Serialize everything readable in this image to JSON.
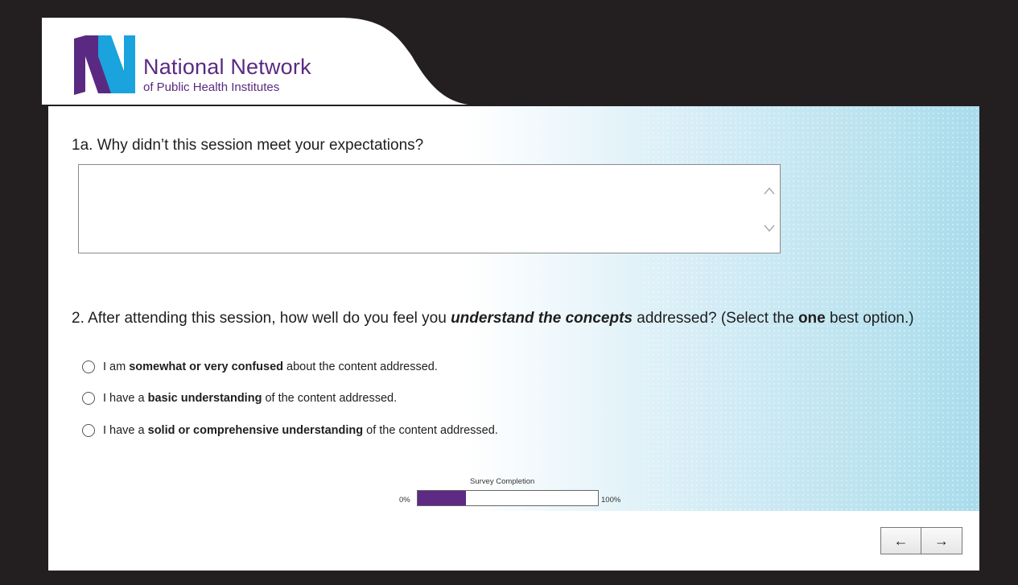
{
  "logo": {
    "line1": "National Network",
    "line2": "of Public Health Institutes",
    "color": "#5a2a82",
    "accent": "#1aa3dd"
  },
  "question1": {
    "text": "1a. Why didn’t this session meet your expectations?",
    "value": "",
    "scroll_up": "^",
    "scroll_down": "v"
  },
  "question2": {
    "part1": "2. After attending this session, how well do you feel you ",
    "emph": "understand the concepts",
    "part2": " addressed? (Select the ",
    "bold": "one",
    "part3": " best option.)"
  },
  "options": [
    {
      "pre": "I am ",
      "bold": "somewhat or very confused",
      "post": " about the content addressed."
    },
    {
      "pre": "I have a ",
      "bold": "basic understanding",
      "post": " of the content addressed."
    },
    {
      "pre": "I have a ",
      "bold": "solid or comprehensive understanding",
      "post": " of the content addressed."
    }
  ],
  "progress": {
    "title": "Survey Completion",
    "left_label": "0%",
    "right_label": "100%",
    "fraction": 0.27,
    "fill_color": "#5e2a84"
  },
  "nav": {
    "back": "←",
    "next": "→"
  }
}
